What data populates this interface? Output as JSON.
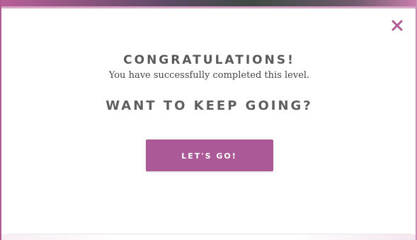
{
  "dialog": {
    "close_icon": "close-x-icon",
    "headline": "CONGRATULATIONS!",
    "subtext": "You have successfully completed this level.",
    "question": "WANT TO KEEP GOING?",
    "cta_label": "LET'S GO!"
  },
  "colors": {
    "accent": "#ab5a97",
    "close_icon": "#b05a94",
    "heading_text": "#5a5a5a",
    "body_text": "#444444",
    "button_text": "#ffffff"
  }
}
